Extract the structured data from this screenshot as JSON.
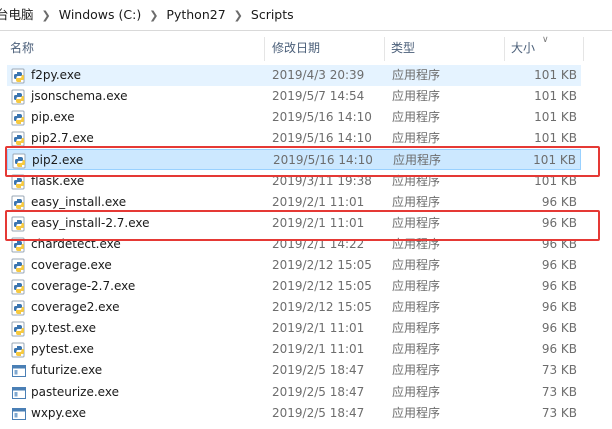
{
  "breadcrumb": [
    "台电脑",
    "Windows (C:)",
    "Python27",
    "Scripts"
  ],
  "columns": {
    "name": "名称",
    "date": "修改日期",
    "type": "类型",
    "size": "大小"
  },
  "sort": {
    "column": "size",
    "direction": "descending"
  },
  "colors": {
    "hover_bg": "#e5f3ff",
    "selected_bg": "#cce8ff",
    "callout": "#e53935"
  },
  "files": [
    {
      "name": "f2py.exe",
      "date": "2019/4/3 20:39",
      "type": "应用程序",
      "size": "101 KB",
      "icon": "python-icon",
      "state": "hover"
    },
    {
      "name": "jsonschema.exe",
      "date": "2019/5/7 14:54",
      "type": "应用程序",
      "size": "101 KB",
      "icon": "python-icon"
    },
    {
      "name": "pip.exe",
      "date": "2019/5/16 14:10",
      "type": "应用程序",
      "size": "101 KB",
      "icon": "python-icon"
    },
    {
      "name": "pip2.7.exe",
      "date": "2019/5/16 14:10",
      "type": "应用程序",
      "size": "101 KB",
      "icon": "python-icon"
    },
    {
      "name": "pip2.exe",
      "date": "2019/5/16 14:10",
      "type": "应用程序",
      "size": "101 KB",
      "icon": "python-icon",
      "state": "selected",
      "highlighted": true
    },
    {
      "name": "flask.exe",
      "date": "2019/3/11 19:38",
      "type": "应用程序",
      "size": "101 KB",
      "icon": "python-icon"
    },
    {
      "name": "easy_install.exe",
      "date": "2019/2/1 11:01",
      "type": "应用程序",
      "size": "96 KB",
      "icon": "python-icon"
    },
    {
      "name": "easy_install-2.7.exe",
      "date": "2019/2/1 11:01",
      "type": "应用程序",
      "size": "96 KB",
      "icon": "python-icon",
      "highlighted": true
    },
    {
      "name": "chardetect.exe",
      "date": "2019/2/1 14:22",
      "type": "应用程序",
      "size": "96 KB",
      "icon": "python-icon"
    },
    {
      "name": "coverage.exe",
      "date": "2019/2/12 15:05",
      "type": "应用程序",
      "size": "96 KB",
      "icon": "python-icon"
    },
    {
      "name": "coverage-2.7.exe",
      "date": "2019/2/12 15:05",
      "type": "应用程序",
      "size": "96 KB",
      "icon": "python-icon"
    },
    {
      "name": "coverage2.exe",
      "date": "2019/2/12 15:05",
      "type": "应用程序",
      "size": "96 KB",
      "icon": "python-icon"
    },
    {
      "name": "py.test.exe",
      "date": "2019/2/1 11:01",
      "type": "应用程序",
      "size": "96 KB",
      "icon": "python-icon"
    },
    {
      "name": "pytest.exe",
      "date": "2019/2/1 11:01",
      "type": "应用程序",
      "size": "96 KB",
      "icon": "python-icon"
    },
    {
      "name": "futurize.exe",
      "date": "2019/2/5 18:47",
      "type": "应用程序",
      "size": "73 KB",
      "icon": "app-window-icon"
    },
    {
      "name": "pasteurize.exe",
      "date": "2019/2/5 18:47",
      "type": "应用程序",
      "size": "73 KB",
      "icon": "app-window-icon"
    },
    {
      "name": "wxpy.exe",
      "date": "2019/2/5 18:47",
      "type": "应用程序",
      "size": "73 KB",
      "icon": "app-window-icon"
    }
  ]
}
